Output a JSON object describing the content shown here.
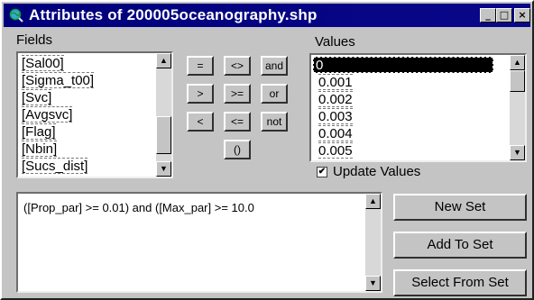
{
  "window": {
    "title": "Attributes of 200005oceanography.shp"
  },
  "titlebar_buttons": {
    "minimize": "_",
    "maximize": "□",
    "close": "×"
  },
  "fields": {
    "label": "Fields",
    "items": [
      "[Sal00]",
      "[Sigma_t00]",
      "[Svc]",
      "[Avgsvc]",
      "[Flag]",
      "[Nbin]",
      "[Sucs_dist]"
    ]
  },
  "operators": {
    "eq": "=",
    "ne": "<>",
    "and": "and",
    "gt": ">",
    "ge": ">=",
    "or": "or",
    "lt": "<",
    "le": "<=",
    "not": "not",
    "paren": "()"
  },
  "values": {
    "label": "Values",
    "items": [
      "0",
      "0.001",
      "0.002",
      "0.003",
      "0.004",
      "0.005"
    ],
    "selected_index": 0
  },
  "update_values": {
    "label": "Update Values",
    "checked": true
  },
  "expression": {
    "text": "([Prop_par] >= 0.01) and ([Max_par] >= 10.0"
  },
  "buttons": {
    "new_set": "New Set",
    "add_to_set": "Add To Set",
    "select_from_set": "Select From Set"
  },
  "icons": {
    "app": "globe-magnifier-icon",
    "scroll_up": "arrow-up-icon",
    "scroll_down": "arrow-down-icon",
    "checkmark": "checkmark-icon"
  },
  "colors": {
    "titlebar": "#00007c",
    "window_face": "#c4c4c4",
    "selection": "#000000"
  }
}
